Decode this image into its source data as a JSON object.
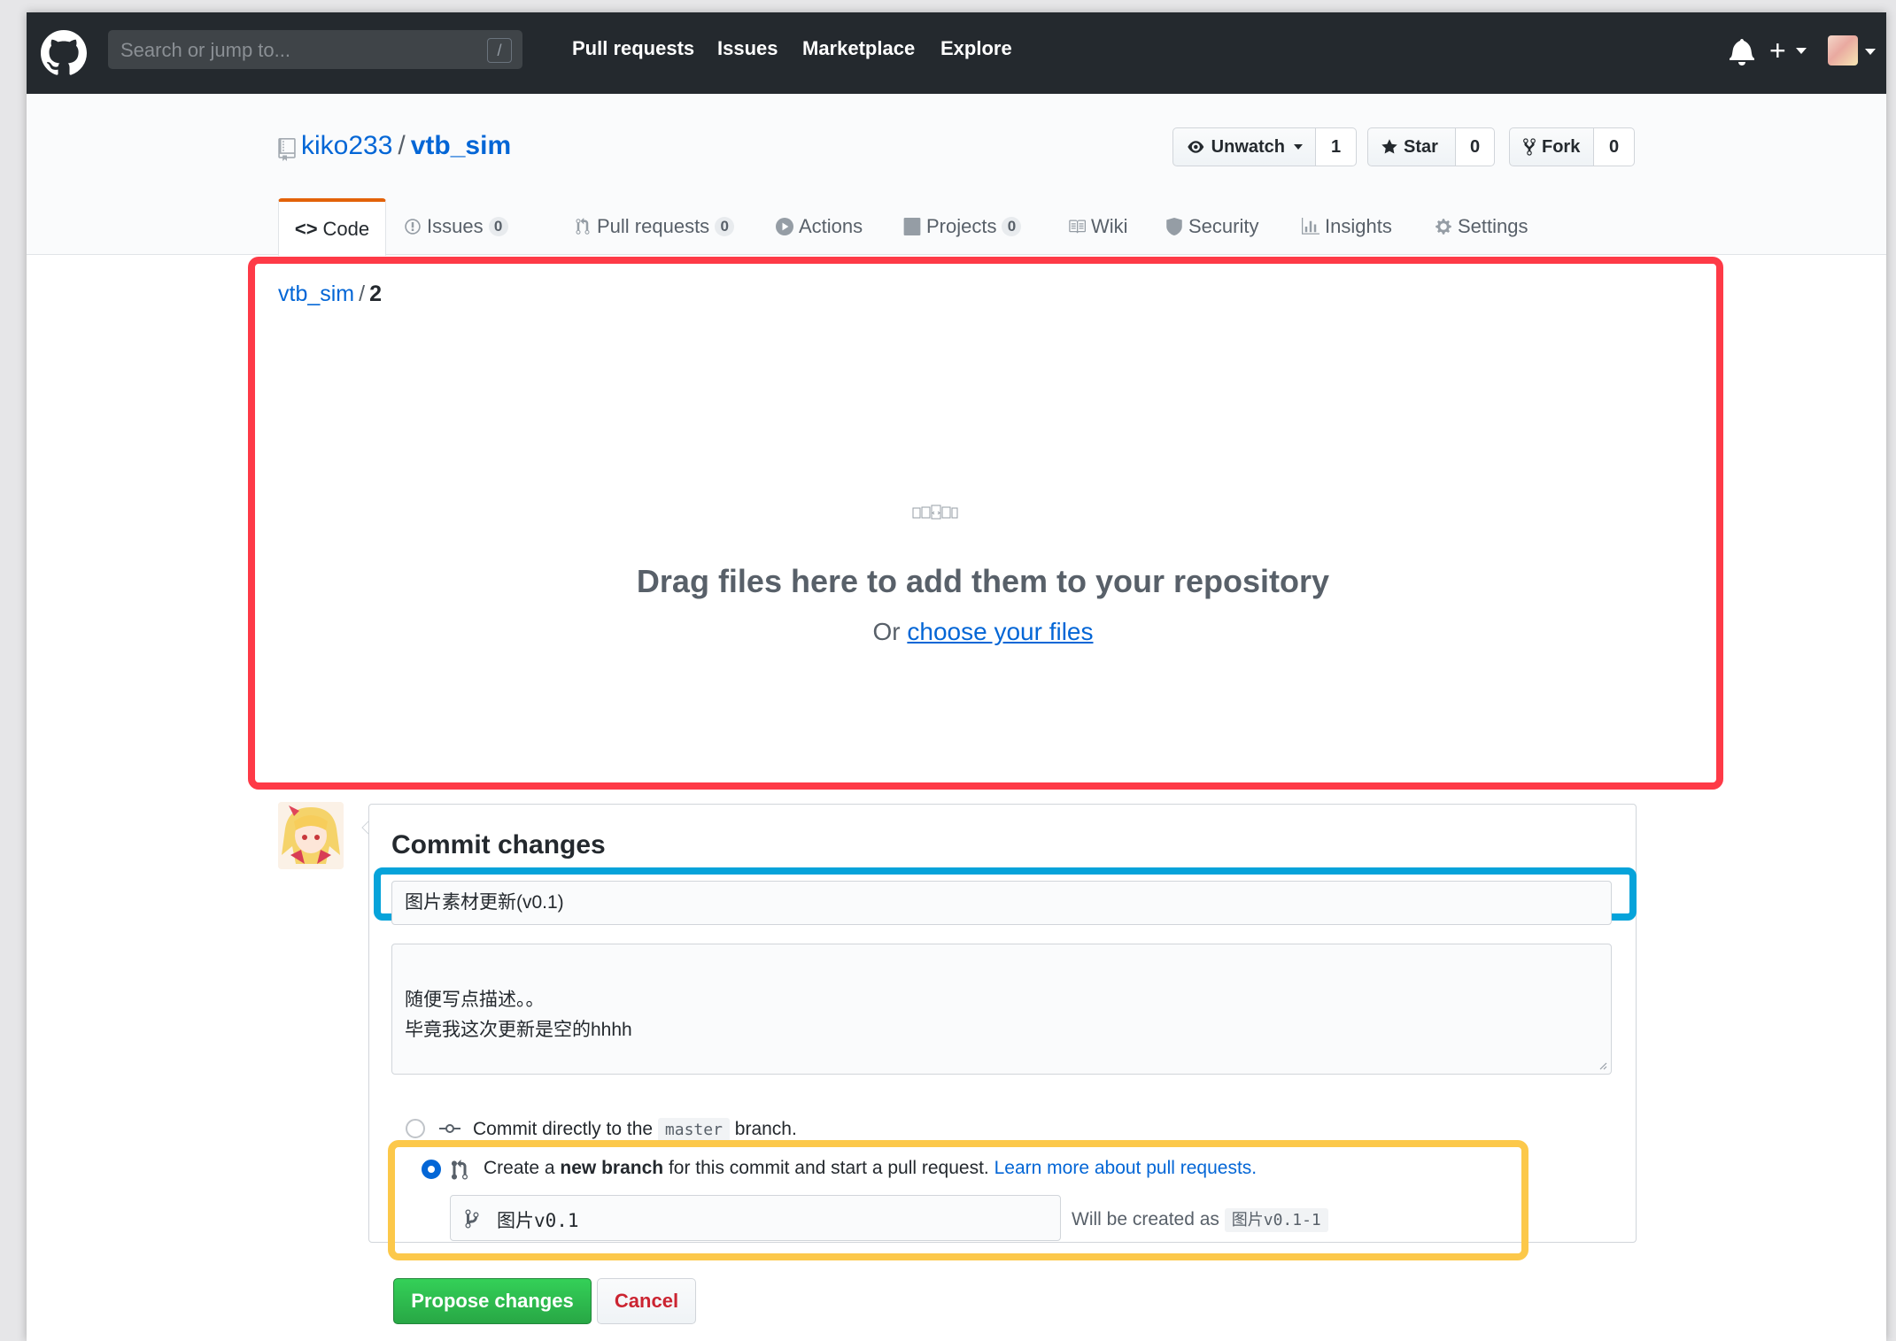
{
  "header": {
    "search_placeholder": "Search or jump to...",
    "slash_key": "/",
    "nav": [
      "Pull requests",
      "Issues",
      "Marketplace",
      "Explore"
    ],
    "plus_label": "+"
  },
  "repo": {
    "owner": "kiko233",
    "separator": "/",
    "name": "vtb_sim",
    "unwatch_label": "Unwatch",
    "watch_count": "1",
    "star_label": "Star",
    "star_count": "0",
    "fork_label": "Fork",
    "fork_count": "0"
  },
  "tabs": {
    "code": "Code",
    "issues": "Issues",
    "issues_count": "0",
    "pulls": "Pull requests",
    "pulls_count": "0",
    "actions": "Actions",
    "projects": "Projects",
    "projects_count": "0",
    "wiki": "Wiki",
    "security": "Security",
    "insights": "Insights",
    "settings": "Settings"
  },
  "breadcrumb": {
    "repo": "vtb_sim",
    "sep": "/",
    "path": "2"
  },
  "dropzone": {
    "title": "Drag files here to add them to your repository",
    "or_text": "Or",
    "choose_link": "choose your files"
  },
  "commit": {
    "heading": "Commit changes",
    "summary_value": "图片素材更新(v0.1)",
    "description_value": "随便写点描述。。\n毕竟我这次更新是空的hhhh",
    "option_direct_prefix": "Commit directly to the",
    "option_direct_branch": "master",
    "option_direct_suffix": "branch.",
    "option_new_prefix": "Create a",
    "option_new_bold": "new branch",
    "option_new_suffix": "for this commit and start a pull request.",
    "option_new_link": "Learn more about pull requests.",
    "branch_value": "图片v0.1",
    "will_be_created": "Will be created as",
    "created_branch": "图片v0.1-1",
    "propose_button": "Propose changes",
    "cancel_button": "Cancel"
  },
  "colors": {
    "annotation_red": "#fe3a47",
    "annotation_blue": "#06a3da",
    "annotation_yellow": "#fcc84a",
    "github_header": "#24292e",
    "link_blue": "#0366d6",
    "primary_green": "#28a745"
  }
}
